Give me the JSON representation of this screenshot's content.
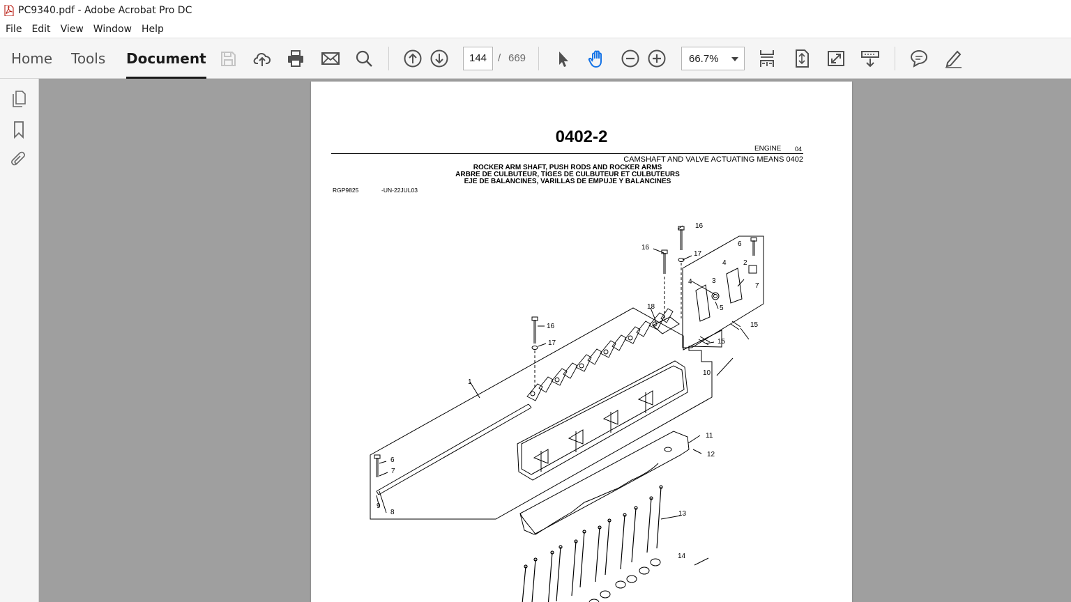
{
  "window": {
    "title": "PC9340.pdf - Adobe Acrobat Pro DC"
  },
  "menu": {
    "items": [
      "File",
      "Edit",
      "View",
      "Window",
      "Help"
    ]
  },
  "toolbar": {
    "tabs": [
      "Home",
      "Tools",
      "Document"
    ],
    "active_tab": "Document",
    "page_current": "144",
    "page_separator": "/",
    "page_total": "669",
    "zoom": "66.7%"
  },
  "colors": {
    "accent": "#1473e6",
    "toolbar_bg": "#f5f5f5",
    "doc_bg": "#9f9f9f"
  },
  "document": {
    "page_number": "0402-2",
    "section": "ENGINE",
    "section_no": "04",
    "group": "CAMSHAFT AND VALVE ACTUATING MEANS 0402",
    "caption_en": "ROCKER ARM SHAFT, PUSH RODS AND ROCKER ARMS",
    "caption_fr": "ARBRE DE CULBUTEUR, TIGES DE CULBUTEUR ET CULBUTEURS",
    "caption_es": "EJE DE BALANCINES, VARILLAS DE EMPUJE Y BALANCINES",
    "ref_code": "RGP9825",
    "ref_date": "-UN-22JUL03",
    "callouts": [
      "1",
      "2",
      "3",
      "4",
      "4",
      "5",
      "6",
      "6",
      "7",
      "7",
      "8",
      "9",
      "10",
      "11",
      "12",
      "13",
      "14",
      "15",
      "15",
      "16",
      "16",
      "16",
      "17",
      "17",
      "18"
    ]
  }
}
